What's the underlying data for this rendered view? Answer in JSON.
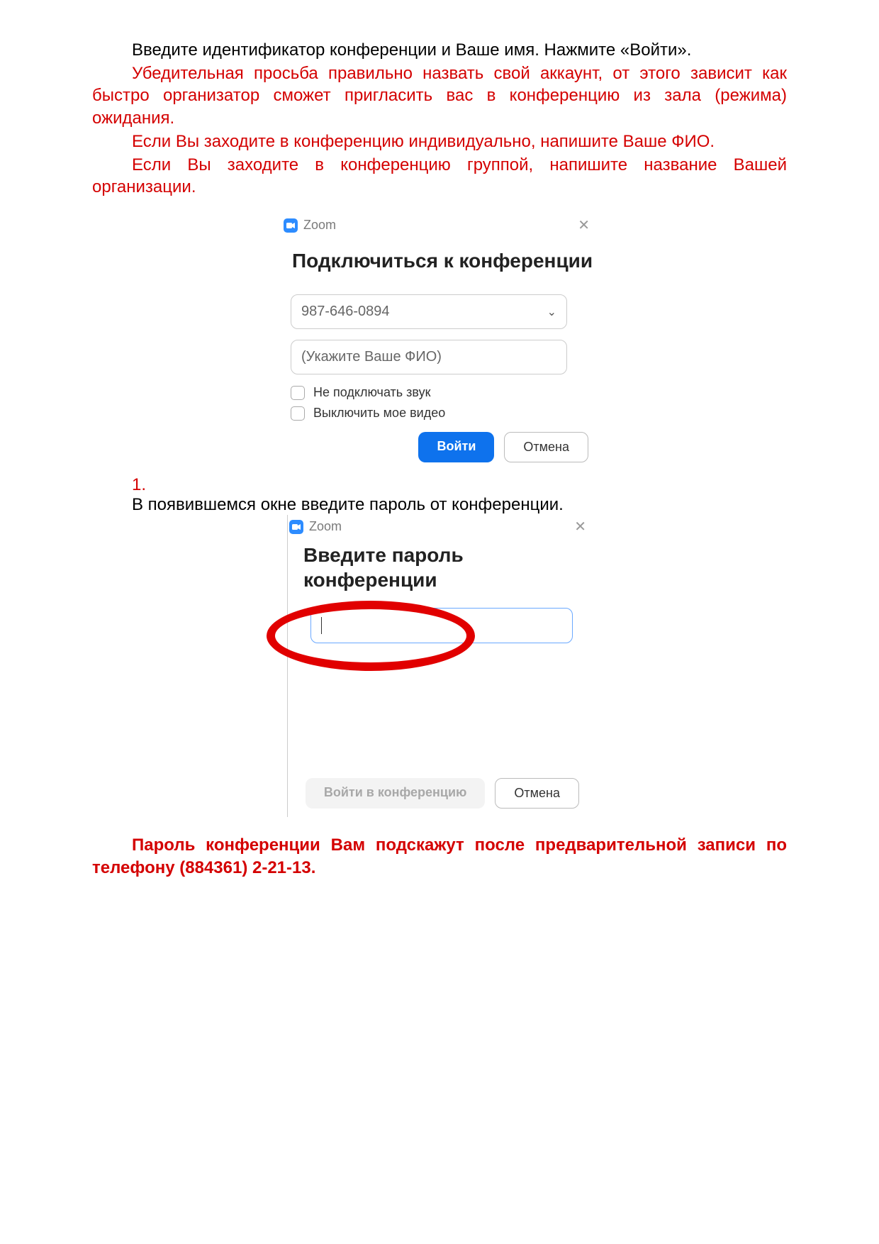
{
  "text": {
    "p1": "Введите идентификатор конференции и Ваше имя. Нажмите «Войти».",
    "p2": "Убедительная просьба правильно назвать свой аккаунт, от этого зависит как быстро организатор сможет пригласить вас в конференцию из зала (режима) ожидания.",
    "p3": "Если Вы заходите в конференцию индивидуально, напишите Ваше ФИО.",
    "p4": "Если Вы заходите в конференцию группой, напишите название Вашей организации.",
    "step_num": "1.",
    "step_text": "В появившемся окне введите пароль от конференции.",
    "footer": "Пароль конференции Вам подскажут после предварительной записи по телефону (884361) 2-21-13."
  },
  "zoom1": {
    "app": "Zoom",
    "title": "Подключиться к конференции",
    "meeting_id": "987-646-0894",
    "name_placeholder": "(Укажите Ваше ФИО)",
    "chk_audio": "Не подключать звук",
    "chk_video": "Выключить мое видео",
    "join": "Войти",
    "cancel": "Отмена"
  },
  "zoom2": {
    "app": "Zoom",
    "title": "Введите пароль конференции",
    "join": "Войти в конференцию",
    "cancel": "Отмена"
  }
}
